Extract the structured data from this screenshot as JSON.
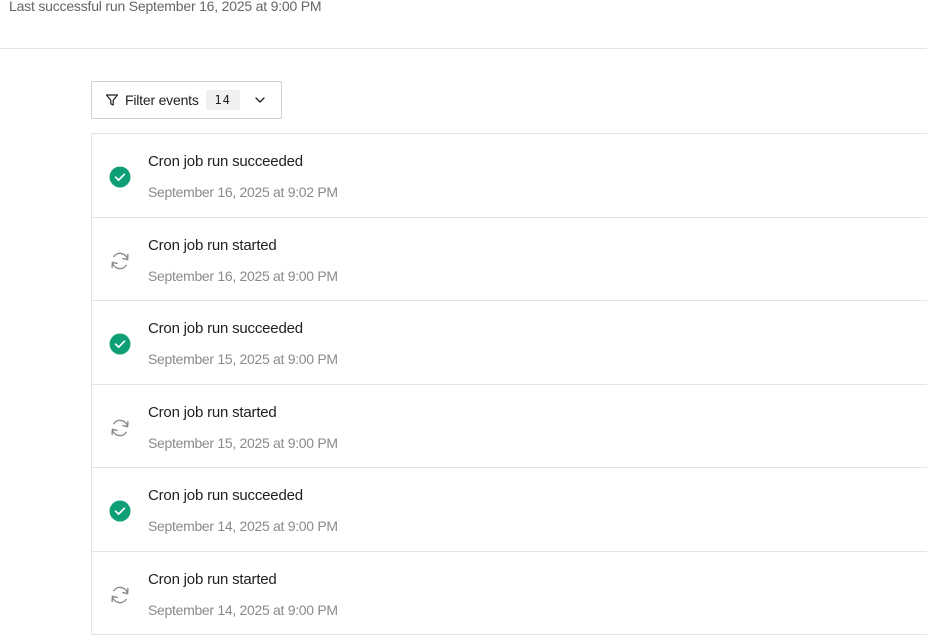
{
  "header": {
    "last_run": "Last successful run September 16, 2025 at 9:00 PM"
  },
  "filter": {
    "label": "Filter events",
    "count": "14"
  },
  "colors": {
    "success": "#0e9f77",
    "muted": "#8a8a8a"
  },
  "events": [
    {
      "title": "Cron job run succeeded",
      "time": "September 16, 2025 at 9:02 PM",
      "status": "success",
      "icon": "check-circle-icon"
    },
    {
      "title": "Cron job run started",
      "time": "September 16, 2025 at 9:00 PM",
      "status": "started",
      "icon": "refresh-icon"
    },
    {
      "title": "Cron job run succeeded",
      "time": "September 15, 2025 at 9:00 PM",
      "status": "success",
      "icon": "check-circle-icon"
    },
    {
      "title": "Cron job run started",
      "time": "September 15, 2025 at 9:00 PM",
      "status": "started",
      "icon": "refresh-icon"
    },
    {
      "title": "Cron job run succeeded",
      "time": "September 14, 2025 at 9:00 PM",
      "status": "success",
      "icon": "check-circle-icon"
    },
    {
      "title": "Cron job run started",
      "time": "September 14, 2025 at 9:00 PM",
      "status": "started",
      "icon": "refresh-icon"
    }
  ]
}
